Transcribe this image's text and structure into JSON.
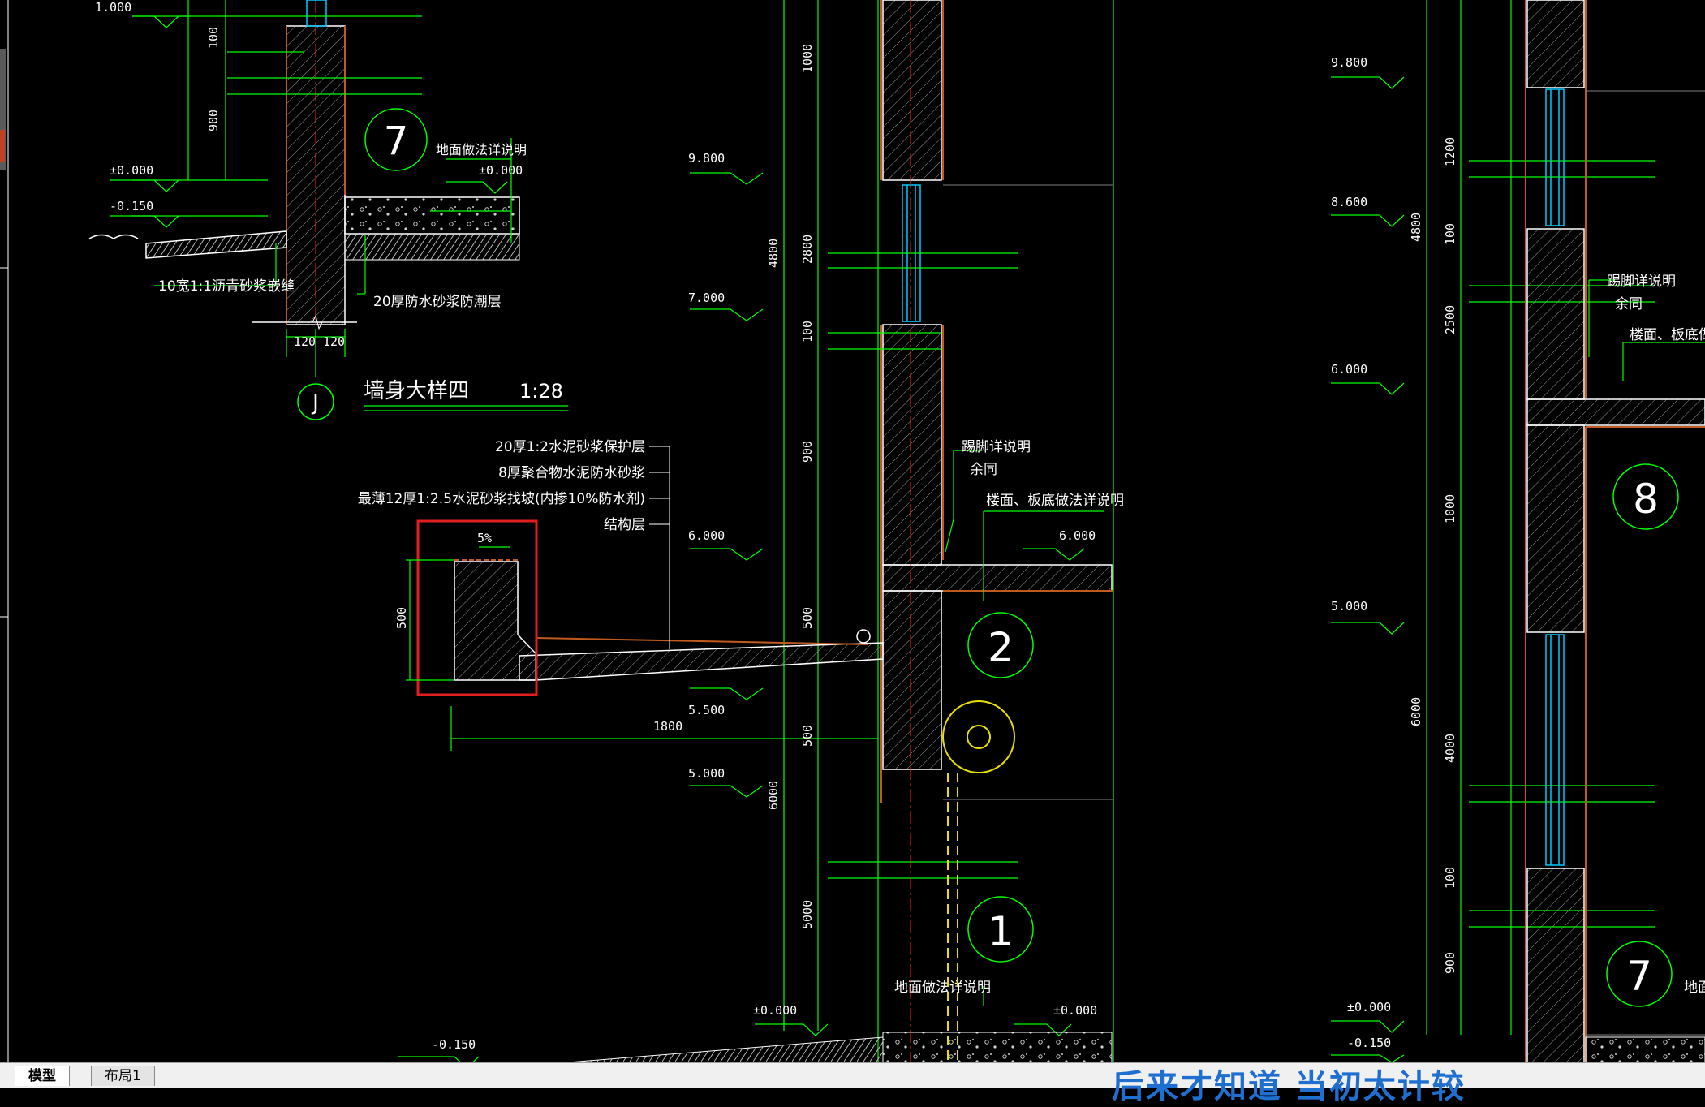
{
  "tabs": [
    {
      "label": "模型",
      "active": true
    },
    {
      "label": "布局1",
      "active": false
    }
  ],
  "watermark": "后来才知道 当初太计较",
  "colors": {
    "background": "#000000",
    "line_white": "#ffffff",
    "line_green": "#00ff00",
    "line_red": "#ff2020",
    "wall_brown": "#c05a20",
    "highlight_box": "#e02020",
    "dim_yellow": "#e8e000"
  },
  "detail_J": {
    "title": "墙身大样四",
    "scale": "1:28",
    "axis": "J",
    "dims": [
      "120",
      "120"
    ],
    "notes": [
      "10宽1:1沥青砂浆嵌缝",
      "20厚防水砂浆防潮层"
    ],
    "elevations": [
      "1.000",
      "±0.000",
      "-0.150"
    ],
    "heights": [
      "100",
      "900"
    ],
    "circle": "7",
    "floor_note": "地面做法详说明",
    "floor_elev": "±0.000"
  },
  "center_detail": {
    "layers": [
      "20厚1:2水泥砂浆保护层",
      "8厚聚合物水泥防水砂浆",
      "最薄12厚1:2.5水泥砂浆找坡(内掺10%防水剂)",
      "结构层"
    ],
    "slope": "5%",
    "parapet_height": "500",
    "overhang_length": "1800",
    "elevations": [
      "9.800",
      "7.000",
      "6.000",
      "5.500",
      "5.000",
      "±0.000",
      "-0.150"
    ],
    "vertical_dims": [
      "1000",
      "4800",
      "2800",
      "100",
      "900",
      "500",
      "500",
      "6000",
      "5000"
    ],
    "notes": [
      "踢脚详说明",
      "余同",
      "楼面、板底做法详说明",
      "地面做法详说明"
    ],
    "right_elevations": [
      "6.000",
      "±0.000"
    ],
    "circles": [
      "2",
      "1"
    ]
  },
  "right_detail": {
    "elevations": [
      "9.800",
      "8.600",
      "6.000",
      "5.000",
      "±0.000",
      "-0.150"
    ],
    "vertical_dims": [
      "1200",
      "100",
      "2500",
      "4800",
      "1000",
      "6000",
      "4000",
      "100",
      "900"
    ],
    "notes": [
      "踢脚详说明",
      "余同",
      "楼面、板底做法详说",
      "地面"
    ],
    "circles": [
      "8",
      "7"
    ]
  }
}
